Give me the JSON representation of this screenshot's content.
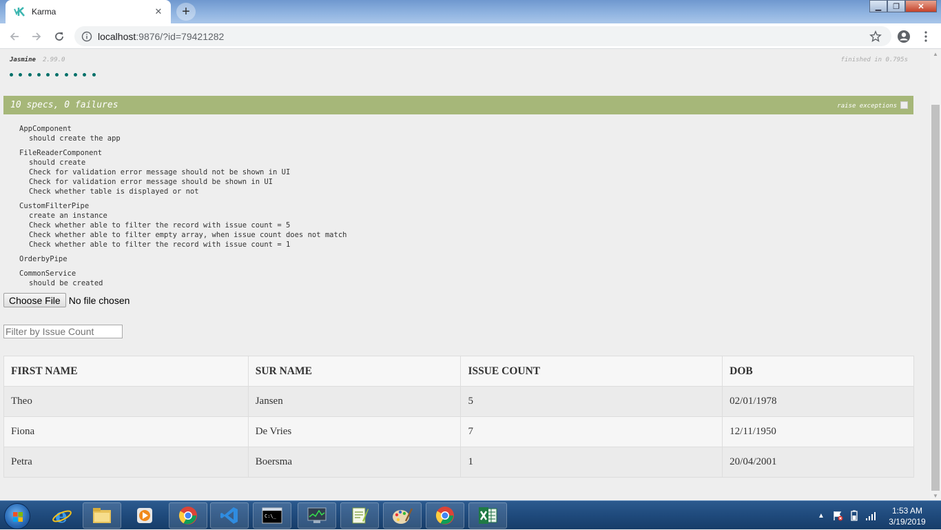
{
  "browser": {
    "tab_title": "Karma",
    "url_host": "localhost",
    "url_path": ":9876/?id=79421282"
  },
  "jasmine": {
    "title": "Jasmine",
    "version": "2.99.0",
    "finished": "finished in 0.795s",
    "dot_count": 10,
    "bar_text": "10 specs, 0 failures",
    "raise_label": "raise exceptions",
    "bar_color": "#a6b779",
    "dot_color": "#007069"
  },
  "suites": [
    {
      "name": "AppComponent",
      "specs": [
        "should create the app"
      ]
    },
    {
      "name": "FileReaderComponent",
      "specs": [
        "should create",
        "Check for validation error message should not be shown in UI",
        "Check for validation error message should be shown in UI",
        "Check whether table is displayed or not"
      ]
    },
    {
      "name": "CustomFilterPipe",
      "specs": [
        "create an instance",
        "Check whether able to filter the record with issue count = 5",
        "Check whether able to filter empty array, when issue count does not match",
        "Check whether able to filter the record with issue count = 1"
      ]
    },
    {
      "name": "OrderbyPipe",
      "specs": []
    },
    {
      "name": "CommonService",
      "specs": [
        "should be created"
      ]
    }
  ],
  "file_input": {
    "button_label": "Choose File",
    "status": "No file chosen"
  },
  "filter": {
    "placeholder": "Filter by Issue Count",
    "value": ""
  },
  "table": {
    "headers": [
      "FIRST NAME",
      "SUR NAME",
      "ISSUE COUNT",
      "DOB"
    ],
    "rows": [
      [
        "Theo",
        "Jansen",
        "5",
        "02/01/1978"
      ],
      [
        "Fiona",
        "De Vries",
        "7",
        "12/11/1950"
      ],
      [
        "Petra",
        "Boersma",
        "1",
        "20/04/2001"
      ]
    ]
  },
  "taskbar": {
    "apps": [
      "start-orb",
      "internet-explorer-icon",
      "file-explorer-icon",
      "media-player-icon",
      "chrome-icon",
      "visual-studio-code-icon",
      "command-prompt-icon",
      "task-manager-icon",
      "notepad-plus-plus-icon",
      "paint-icon",
      "chrome-icon",
      "excel-icon"
    ],
    "clock_time": "1:53 AM",
    "clock_date": "3/19/2019"
  }
}
